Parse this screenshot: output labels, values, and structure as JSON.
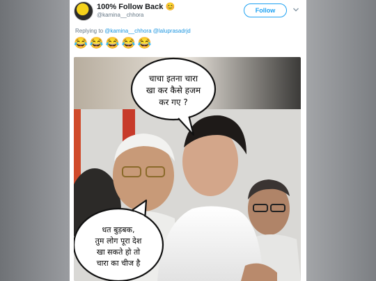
{
  "tweet": {
    "display_name": "100% Follow Back",
    "name_emoji": "😊",
    "handle": "@kamina__chhora",
    "follow_label": "Follow",
    "avatar_icon": "avatar-image",
    "replying_prefix": "Replying to",
    "replying_to": [
      "@kamina__chhora",
      "@laluprasadrjd"
    ],
    "emoji_text": "😂😂😂😂😂",
    "accent_color": "#1da1f2"
  },
  "meme": {
    "top_bubble": [
      "चाचा इतना चारा",
      "खा कर कैसे हजम",
      "कर गए ?"
    ],
    "bottom_bubble": [
      "धत बुड़बक,",
      "तुम लोग पूरा देश",
      "खा सकते हो तो",
      "चारा का चीज है"
    ]
  }
}
